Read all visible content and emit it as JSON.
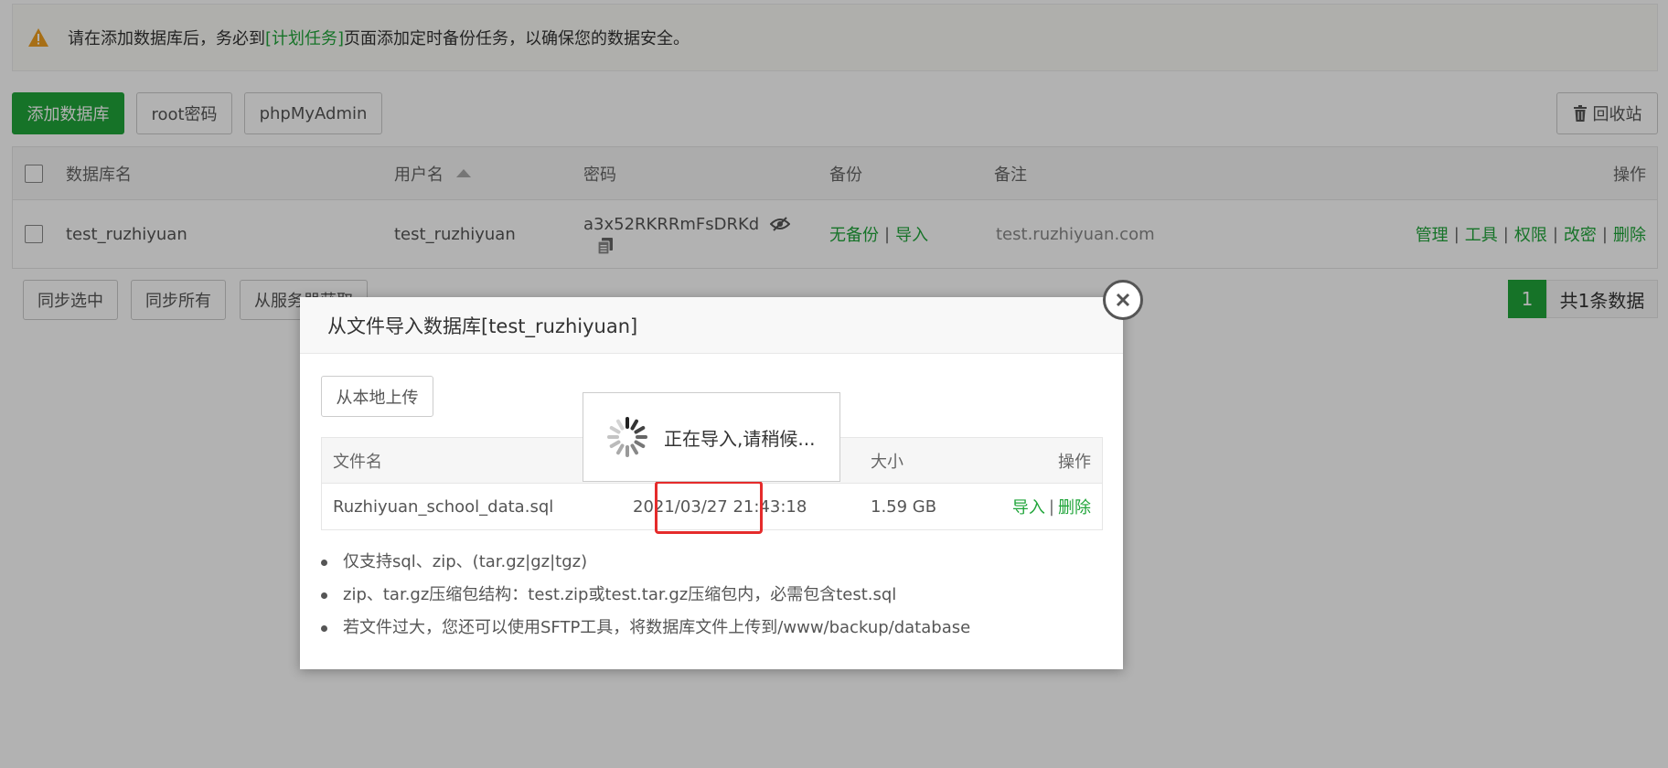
{
  "alert": {
    "text_before": "请在添加数据库后，务必到",
    "link": "[计划任务]",
    "text_after": "页面添加定时备份任务，以确保您的数据安全。"
  },
  "toolbar": {
    "add_db": "添加数据库",
    "root_password": "root密码",
    "phpmyadmin": "phpMyAdmin",
    "recycle_bin": "回收站"
  },
  "table": {
    "headers": {
      "name": "数据库名",
      "username": "用户名",
      "password": "密码",
      "backup": "备份",
      "remark": "备注",
      "actions": "操作"
    },
    "rows": [
      {
        "name": "test_ruzhiyuan",
        "username": "test_ruzhiyuan",
        "password": "a3x52RKRRmFsDRKd",
        "backup_status": "无备份",
        "import": "导入",
        "remark": "test.ruzhiyuan.com",
        "actions": [
          "管理",
          "工具",
          "权限",
          "改密",
          "删除"
        ]
      }
    ]
  },
  "bottom": {
    "sync_selected": "同步选中",
    "sync_all": "同步所有",
    "from_server": "从服务器获取"
  },
  "pager": {
    "page": "1",
    "total": "共1条数据"
  },
  "modal": {
    "title": "从文件导入数据库[test_ruzhiyuan]",
    "upload_local": "从本地上传",
    "headers": {
      "filename": "文件名",
      "size": "大小",
      "actions": "操作"
    },
    "file": {
      "name": "Ruzhiyuan_school_data.sql",
      "time": "2021/03/27 21:43:18",
      "size": "1.59 GB",
      "import": "导入",
      "delete": "删除"
    },
    "notes": [
      "仅支持sql、zip、(tar.gz|gz|tgz)",
      "zip、tar.gz压缩包结构：test.zip或test.tar.gz压缩包内，必需包含test.sql",
      "若文件过大，您还可以使用SFTP工具，将数据库文件上传到/www/backup/database"
    ]
  },
  "loading": {
    "text": "正在导入,请稍候..."
  },
  "colors": {
    "accent": "#20a53a",
    "highlight": "#e52b2b",
    "warning": "#f0a020"
  }
}
